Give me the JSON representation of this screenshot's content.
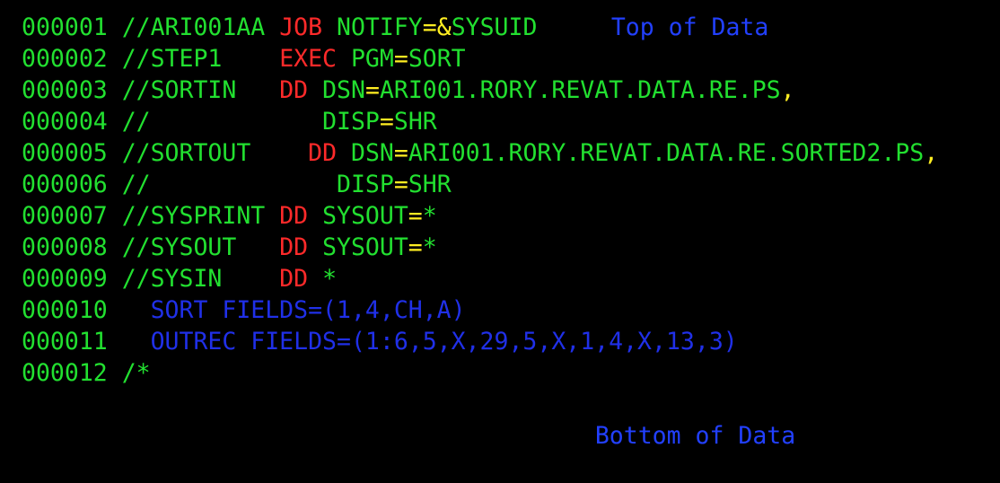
{
  "colors": {
    "background": "#000000",
    "green": "#22e030",
    "red": "#ff2a2a",
    "yellow": "#ffee22",
    "blue": "#2030e8",
    "cut": "#2240ff"
  },
  "header": {
    "text": "Top of Data",
    "color": "blue"
  },
  "footer": {
    "text": "Bottom of Data",
    "color": "blue"
  },
  "lines": [
    {
      "segments": [
        {
          "text": "000001 ",
          "color": "green"
        },
        {
          "text": "//ARI001AA ",
          "color": "green"
        },
        {
          "text": "JOB ",
          "color": "red"
        },
        {
          "text": "NOTIFY",
          "color": "green"
        },
        {
          "text": "=",
          "color": "yellow"
        },
        {
          "text": "&",
          "color": "yellow"
        },
        {
          "text": "SYSUID",
          "color": "green"
        }
      ]
    },
    {
      "segments": [
        {
          "text": "000002 ",
          "color": "green"
        },
        {
          "text": "//STEP1    ",
          "color": "green"
        },
        {
          "text": "EXEC ",
          "color": "red"
        },
        {
          "text": "PGM",
          "color": "green"
        },
        {
          "text": "=",
          "color": "yellow"
        },
        {
          "text": "SORT",
          "color": "green"
        }
      ]
    },
    {
      "segments": [
        {
          "text": "000003 ",
          "color": "green"
        },
        {
          "text": "//SORTIN   ",
          "color": "green"
        },
        {
          "text": "DD ",
          "color": "red"
        },
        {
          "text": "DSN",
          "color": "green"
        },
        {
          "text": "=",
          "color": "yellow"
        },
        {
          "text": "ARI001.RORY.REVAT.DATA.RE.PS",
          "color": "green"
        },
        {
          "text": ",",
          "color": "yellow"
        }
      ]
    },
    {
      "segments": [
        {
          "text": "000004 ",
          "color": "green"
        },
        {
          "text": "//            ",
          "color": "green"
        },
        {
          "text": "DISP",
          "color": "green"
        },
        {
          "text": "=",
          "color": "yellow"
        },
        {
          "text": "SHR",
          "color": "green"
        }
      ]
    },
    {
      "segments": [
        {
          "text": "000005 ",
          "color": "green"
        },
        {
          "text": "//SORTOUT    ",
          "color": "green"
        },
        {
          "text": "DD ",
          "color": "red"
        },
        {
          "text": "DSN",
          "color": "green"
        },
        {
          "text": "=",
          "color": "yellow"
        },
        {
          "text": "ARI001.RORY.REVAT.DATA.RE.SORTED2.PS",
          "color": "green"
        },
        {
          "text": ",",
          "color": "yellow"
        }
      ]
    },
    {
      "segments": [
        {
          "text": "000006 ",
          "color": "green"
        },
        {
          "text": "//             ",
          "color": "green"
        },
        {
          "text": "DISP",
          "color": "green"
        },
        {
          "text": "=",
          "color": "yellow"
        },
        {
          "text": "SHR",
          "color": "green"
        }
      ]
    },
    {
      "segments": [
        {
          "text": "000007 ",
          "color": "green"
        },
        {
          "text": "//SYSPRINT ",
          "color": "green"
        },
        {
          "text": "DD ",
          "color": "red"
        },
        {
          "text": "SYSOUT",
          "color": "green"
        },
        {
          "text": "=",
          "color": "yellow"
        },
        {
          "text": "*",
          "color": "green"
        }
      ]
    },
    {
      "segments": [
        {
          "text": "000008 ",
          "color": "green"
        },
        {
          "text": "//SYSOUT   ",
          "color": "green"
        },
        {
          "text": "DD ",
          "color": "red"
        },
        {
          "text": "SYSOUT",
          "color": "green"
        },
        {
          "text": "=",
          "color": "yellow"
        },
        {
          "text": "*",
          "color": "green"
        }
      ]
    },
    {
      "segments": [
        {
          "text": "000009 ",
          "color": "green"
        },
        {
          "text": "//SYSIN    ",
          "color": "green"
        },
        {
          "text": "DD ",
          "color": "red"
        },
        {
          "text": "*",
          "color": "green"
        }
      ]
    },
    {
      "segments": [
        {
          "text": "000010 ",
          "color": "green"
        },
        {
          "text": "  SORT FIELDS=(1,4,CH,A)",
          "color": "blue"
        }
      ]
    },
    {
      "segments": [
        {
          "text": "000011 ",
          "color": "green"
        },
        {
          "text": "  OUTREC FIELDS=(1:6,5,X,29,5,X,1,4,X,13,3)",
          "color": "blue"
        }
      ]
    },
    {
      "segments": [
        {
          "text": "000012 ",
          "color": "green"
        },
        {
          "text": "/*",
          "color": "green"
        }
      ]
    }
  ]
}
